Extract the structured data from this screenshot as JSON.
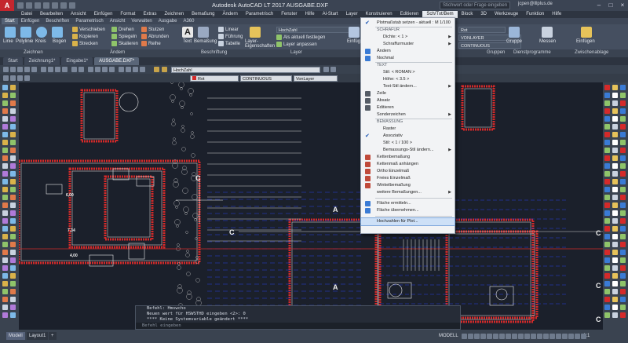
{
  "app": {
    "logo": "A",
    "title": "Autodesk AutoCAD LT 2017    AUSGABE.DXF",
    "search_placeholder": "Stichwort oder Frage eingeben",
    "user": "jcpen@lllplus.de"
  },
  "menubar": [
    "Datei",
    "Bearbeiten",
    "Ansicht",
    "Einfügen",
    "Format",
    "Extras",
    "Zeichnen",
    "Bemaßung",
    "Ändern",
    "Parametrisch",
    "Fenster",
    "Hilfe",
    "Al-Start",
    "Layer",
    "Konstruieren",
    "Editieren",
    "Sch/Txt/Bem",
    "Block",
    "3D",
    "Werkzeuge",
    "Funktion",
    "Hilfe"
  ],
  "menubar_active_index": 16,
  "ribbon_tabs": [
    "Start",
    "Einfügen",
    "Beschriften",
    "Parametrisch",
    "Ansicht",
    "Verwalten",
    "Ausgabe",
    "A360"
  ],
  "ribbon": {
    "tools": [
      "Linie",
      "Polylinie",
      "Kreis",
      "Bogen",
      "Verschieben",
      "Kopieren",
      "Strecken",
      "Drehen",
      "Spiegeln",
      "Skalieren",
      "Stutzen",
      "Abrunden",
      "Reihe",
      "Text",
      "Bemaßung",
      "Linear",
      "Führung",
      "Tabelle",
      "Layer-Eigenschaften",
      "HochZahl",
      "Als aktuell festlegen",
      "Layer anpassen",
      "Einfügen",
      "Rot",
      "VONLAYER",
      "CONTINUOUS",
      "Messen",
      "Gruppe"
    ],
    "groups": [
      "Zeichnen",
      "Ändern",
      "Beschriftung",
      "Layer",
      "Gruppen",
      "Dienstprogramme",
      "Zwischenablage"
    ]
  },
  "doc_tabs": [
    "Start",
    "Zeichnung1*",
    "Eingabe1*",
    "AUSGABE.DXF*"
  ],
  "doc_tab_active": 3,
  "propbar": {
    "layer": "HochZahl",
    "color": "Rot",
    "linetype": "CONTINUOUS",
    "lineweight": "VonLayer"
  },
  "canvas_labels": [
    "C",
    "A",
    "C",
    "C",
    "A",
    "A",
    "C",
    "C",
    "7,34",
    "6,00",
    "4,00"
  ],
  "dropdown": {
    "items": [
      {
        "type": "item",
        "label": "Plotmaßstab setzen - aktuell : M 1/100",
        "check": true
      },
      {
        "type": "head",
        "label": "SCHRAFUR"
      },
      {
        "type": "item",
        "label": "Dichte:    < 1 >",
        "indent": true,
        "arrow": true
      },
      {
        "type": "item",
        "label": "Schraffurmuster",
        "indent": true,
        "arrow": true
      },
      {
        "type": "item",
        "label": "Ändern",
        "icon": "#3a7bd5"
      },
      {
        "type": "item",
        "label": "Nochmal",
        "icon": "#3a7bd5"
      },
      {
        "type": "head",
        "label": "TEXT"
      },
      {
        "type": "item",
        "label": "Stil:      < ROMAN >",
        "indent": true
      },
      {
        "type": "item",
        "label": "Höhe:      < 3.5 >",
        "indent": true
      },
      {
        "type": "item",
        "label": "Text-Stil ändern...",
        "indent": true,
        "arrow": true
      },
      {
        "type": "item",
        "label": "Zeile",
        "icon": "#555c66"
      },
      {
        "type": "item",
        "label": "Absatz",
        "icon": "#555c66"
      },
      {
        "type": "item",
        "label": "Editieren",
        "icon": "#555c66"
      },
      {
        "type": "item",
        "label": "Sonderzeichen",
        "arrow": true
      },
      {
        "type": "head",
        "label": "BEMASSUNG"
      },
      {
        "type": "item",
        "label": "Raster",
        "indent": true
      },
      {
        "type": "item",
        "label": "Assoziativ",
        "check": true,
        "indent": true
      },
      {
        "type": "item",
        "label": "Stil:      < 1 / 100 >",
        "indent": true
      },
      {
        "type": "item",
        "label": "Bemassungs-Stil ändern...",
        "indent": true,
        "arrow": true
      },
      {
        "type": "item",
        "label": "Kettenbemaßung",
        "icon": "#c04a3a"
      },
      {
        "type": "item",
        "label": "Kettenmaß anhängen",
        "icon": "#c04a3a"
      },
      {
        "type": "item",
        "label": "Ortho Einzelmaß",
        "icon": "#c04a3a"
      },
      {
        "type": "item",
        "label": "Freies Einzelmaß",
        "icon": "#c04a3a"
      },
      {
        "type": "item",
        "label": "Winkelbemaßung",
        "icon": "#c04a3a"
      },
      {
        "type": "item",
        "label": "weitere Bemaßungen...",
        "arrow": true
      },
      {
        "type": "sep"
      },
      {
        "type": "item",
        "label": "Fläche ermitteln...",
        "icon": "#3a7bd5"
      },
      {
        "type": "item",
        "label": "Fläche übernehmen...",
        "icon": "#3a7bd5"
      },
      {
        "type": "sep"
      },
      {
        "type": "item",
        "label": "Hochzahlen für Plot...",
        "highlight": true
      }
    ]
  },
  "cmd": {
    "lines": [
      "Befehl: Hmswcho",
      "Neuen wert für HSWSTHD eingeben <2>: 0",
      "**** Keine Systemvariable geändert ****"
    ],
    "input": "Befehl eingeben"
  },
  "status": {
    "tabs": [
      "Modell",
      "Layout1",
      "+"
    ],
    "model_label": "MODELL",
    "scale": "1:1"
  },
  "colors": {
    "accent": "#c4262e",
    "canvas": "#1b202b",
    "wall": "#d42a2a",
    "dim": "#2a3fe8",
    "hatch": "#c8c8c8"
  }
}
